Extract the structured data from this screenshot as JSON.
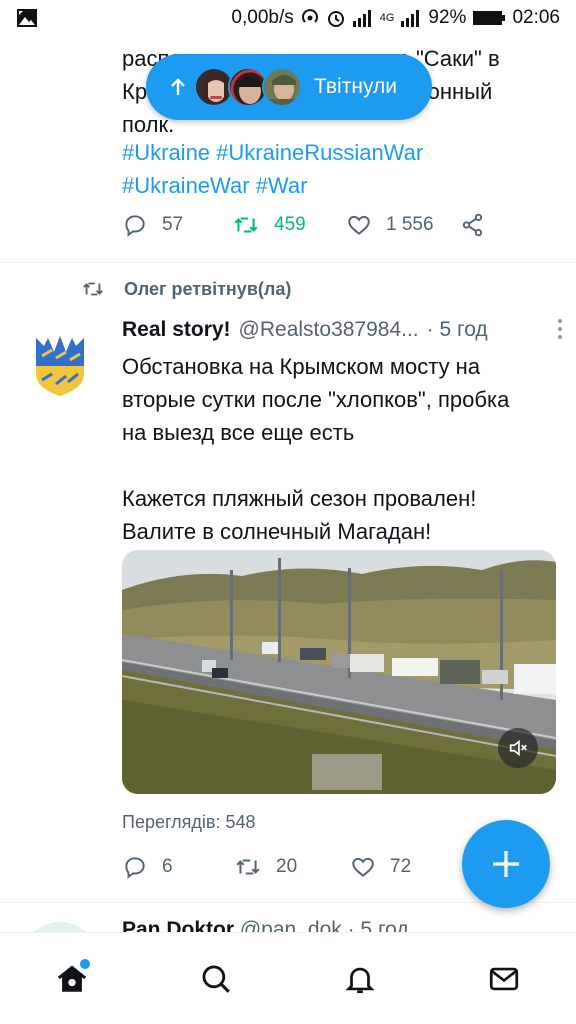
{
  "status_bar": {
    "speed": "0,00b/s",
    "network": "4G",
    "battery": "92%",
    "time": "02:06"
  },
  "tweet1": {
    "text_lines": [
      "расположены на аэродроме \"Саки\" в",
      "Крыму, это отдельный авиационный",
      "полк."
    ],
    "hashtags": [
      "#Ukraine #UkraineRussianWar",
      "#UkraineWar #War"
    ],
    "reply_count": "57",
    "retweet_count": "459",
    "like_count": "1 556"
  },
  "new_tweets_pill": {
    "label": "Твітнули"
  },
  "tweet2": {
    "retweeted_by": "Олег ретвітнув(ла)",
    "author_name": "Real story!",
    "author_handle": "@Realsto387984...",
    "time": "· 5 год",
    "text_lines": [
      "Обстановка на Крымском мосту на",
      "вторые сутки после \"хлопков\", пробка",
      "на выезд все еще есть",
      "",
      "Кажется пляжный сезон провален!",
      "Валите в солнечный Магадан!"
    ],
    "views": "Переглядів: 548",
    "reply_count": "6",
    "retweet_count": "20",
    "like_count": "72"
  },
  "tweet3": {
    "author_name": "Pan Doktor",
    "author_handle": "@pan_dok",
    "time": "· 5 год"
  },
  "colors": {
    "accent": "#1d9bf0",
    "retweet_green": "#00ba7c",
    "secondary_text": "#536471"
  },
  "icons": {
    "gallery": "image-icon",
    "reply": "speech-bubble-icon",
    "retweet": "retweet-arrows-icon",
    "like": "heart-icon",
    "share": "share-icon",
    "more": "more-dots-icon",
    "mute": "speaker-muted-icon",
    "compose": "plus-icon",
    "home": "home-icon",
    "search": "search-icon",
    "notifications": "bell-icon",
    "messages": "envelope-icon"
  }
}
